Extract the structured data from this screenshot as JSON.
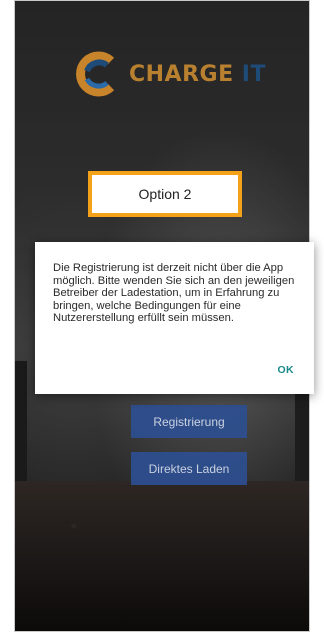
{
  "app": {
    "brand_word": "CHARGE",
    "brand_accent": "IT",
    "colors": {
      "brand_orange": "#b9812f",
      "brand_blue": "#1f4b78",
      "highlight": "#f5a21b",
      "button": "#2d4f91",
      "dialog_action": "#1a8a8a"
    }
  },
  "option_label": "Option 2",
  "buttons": {
    "register": "Registrierung",
    "direct_charge": "Direktes Laden"
  },
  "dialog": {
    "message": "Die Registrierung ist derzeit nicht über die App möglich. Bitte wenden Sie sich an den jeweiligen Betreiber der Ladestation, um in Erfahrung zu bringen, welche Bedingungen für eine Nutzererstellung erfüllt sein müssen.",
    "ok": "OK"
  },
  "icons": {
    "logo": "charge-it-logo-icon"
  }
}
